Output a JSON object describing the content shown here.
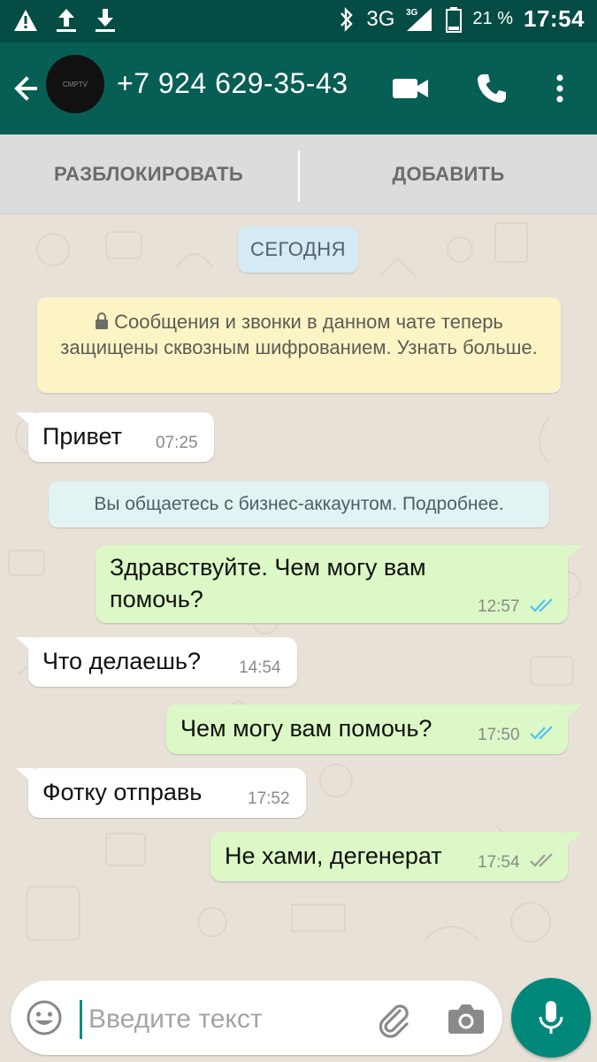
{
  "status_bar": {
    "network": "3G",
    "network_small": "3G",
    "battery": "21 %",
    "time": "17:54"
  },
  "header": {
    "contact": "+7 924 629-35-43",
    "avatar_text": "CMPTV"
  },
  "block_bar": {
    "unblock": "РАЗБЛОКИРОВАТЬ",
    "add": "ДОБАВИТЬ"
  },
  "chat": {
    "date": "СЕГОДНЯ",
    "encryption": "Сообщения и звонки в данном чате теперь защищены сквозным шифрованием. Узнать больше.",
    "business_notice": "Вы общаетесь с бизнес-аккаунтом. Подробнее.",
    "messages": [
      {
        "dir": "in",
        "text": "Привет",
        "time": "07:25"
      },
      {
        "dir": "out",
        "text_line1": "Здравствуйте. Чем могу вам",
        "text_line2": "помочь?",
        "time": "12:57",
        "status": "read"
      },
      {
        "dir": "in",
        "text": "Что делаешь?",
        "time": "14:54"
      },
      {
        "dir": "out",
        "text": "Чем могу вам помочь?",
        "time": "17:50",
        "status": "read"
      },
      {
        "dir": "in",
        "text": "Фотку отправь",
        "time": "17:52"
      },
      {
        "dir": "out",
        "text": "Не хами, дегенерат",
        "time": "17:54",
        "status": "delivered"
      }
    ]
  },
  "input": {
    "placeholder": "Введите текст"
  },
  "colors": {
    "header": "#075e54",
    "statusbar": "#054d44",
    "outgoing": "#dcf8c6",
    "incoming": "#ffffff",
    "read_ticks": "#4fc3f7",
    "delivered_ticks": "#9e9e9e",
    "accent": "#00897b"
  },
  "icons": {
    "warning": "warning-icon",
    "upload": "upload-icon",
    "download": "download-icon",
    "bluetooth": "bluetooth-icon",
    "signal": "signal-icon",
    "battery": "battery-icon",
    "back": "back-arrow-icon",
    "video": "video-call-icon",
    "phone": "phone-call-icon",
    "menu": "more-vert-icon",
    "lock": "lock-icon",
    "emoji": "emoji-icon",
    "attach": "paperclip-icon",
    "camera": "camera-icon",
    "mic": "mic-icon"
  }
}
